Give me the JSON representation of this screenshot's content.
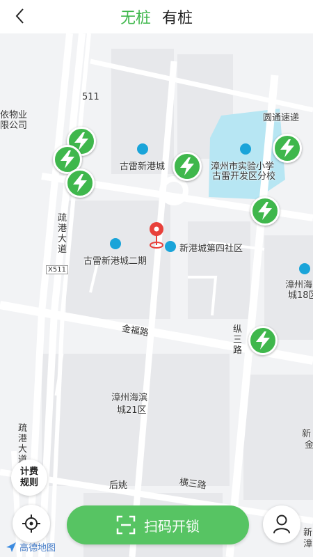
{
  "header": {
    "tabs": [
      {
        "label": "无桩",
        "active": true
      },
      {
        "label": "有桩",
        "active": false
      }
    ]
  },
  "map": {
    "pois": [
      {
        "label": "依物业"
      },
      {
        "label": "限公司"
      },
      {
        "label": "圆通速递"
      },
      {
        "label": "古雷新港城"
      },
      {
        "label": "漳州市实验小学"
      },
      {
        "label": "古雷开发区分校"
      },
      {
        "label": "新港城第四社区"
      },
      {
        "label": "古雷新港城二期"
      },
      {
        "label": "漳州海"
      },
      {
        "label": "城18区"
      },
      {
        "label": "漳州海滨"
      },
      {
        "label": "城21区"
      },
      {
        "label": "后姚"
      },
      {
        "label": "新"
      },
      {
        "label": "金"
      },
      {
        "label": "新"
      },
      {
        "label": "漳"
      }
    ],
    "roads": [
      {
        "label": "511"
      },
      {
        "label": "疏港大道"
      },
      {
        "label": "X511"
      },
      {
        "label": "金福路"
      },
      {
        "label": "纵三路"
      },
      {
        "label": "疏港大道"
      },
      {
        "label": "横三路"
      }
    ],
    "marker_colors": {
      "charger": "#3fb74c",
      "pin": "#e8403a",
      "accent": "#57c463"
    }
  },
  "controls": {
    "fee_rules": [
      "计费",
      "规则"
    ],
    "scan_label": "扫码开锁",
    "logo_text": "高德地图"
  }
}
